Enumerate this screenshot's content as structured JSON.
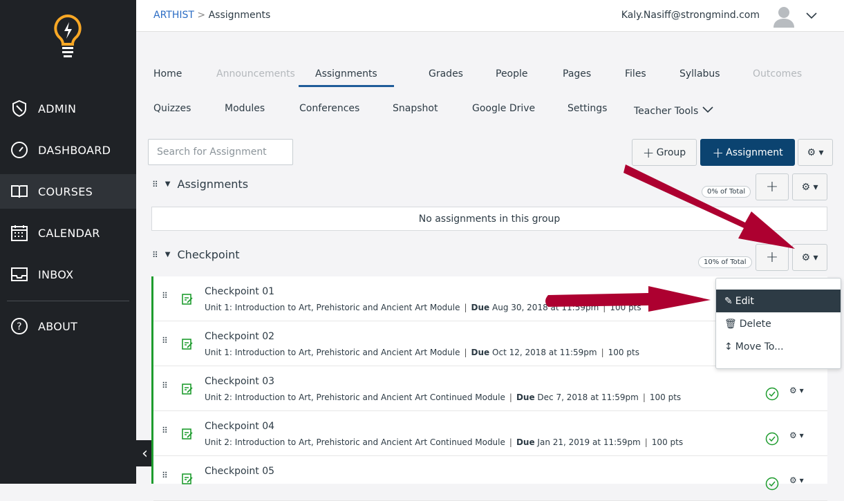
{
  "sidebar": {
    "items": [
      {
        "label": "ADMIN",
        "icon": "shield-icon"
      },
      {
        "label": "DASHBOARD",
        "icon": "dashboard-icon"
      },
      {
        "label": "COURSES",
        "icon": "book-icon",
        "active": true
      },
      {
        "label": "CALENDAR",
        "icon": "calendar-icon"
      },
      {
        "label": "INBOX",
        "icon": "inbox-icon"
      },
      {
        "label": "ABOUT",
        "icon": "help-icon"
      }
    ]
  },
  "header": {
    "breadcrumb_course": "ARTHIST",
    "breadcrumb_sep": ">",
    "breadcrumb_page": "Assignments",
    "user_email": "Kaly.Nasiff@strongmind.com"
  },
  "tabs": [
    "Home",
    "Announcements",
    "Assignments",
    "Grades",
    "People",
    "Pages",
    "Files",
    "Syllabus",
    "Outcomes",
    "Quizzes",
    "Modules",
    "Conferences",
    "Snapshot",
    "Google Drive",
    "Settings",
    "Teacher Tools"
  ],
  "toolbar": {
    "search_placeholder": "Search for Assignment",
    "group_button": "Group",
    "assignment_button": "Assignment"
  },
  "groups": [
    {
      "title": "Assignments",
      "weight": "0% of Total",
      "empty_text": "No assignments in this group"
    },
    {
      "title": "Checkpoint",
      "weight": "10% of Total"
    }
  ],
  "assignments": [
    {
      "title": "Checkpoint 01",
      "module": "Unit 1: Introduction to Art, Prehistoric and Ancient Art Module",
      "due_label": "Due",
      "due": "Aug 30, 2018 at 11:59pm",
      "points": "100 pts"
    },
    {
      "title": "Checkpoint 02",
      "module": "Unit 1: Introduction to Art, Prehistoric and Ancient Art Module",
      "due_label": "Due",
      "due": "Oct 12, 2018 at 11:59pm",
      "points": "100 pts"
    },
    {
      "title": "Checkpoint 03",
      "module": "Unit 2: Introduction to Art, Prehistoric and Ancient Art Continued Module",
      "due_label": "Due",
      "due": "Dec 7, 2018 at 11:59pm",
      "points": "100 pts",
      "published": true
    },
    {
      "title": "Checkpoint 04",
      "module": "Unit 2: Introduction to Art, Prehistoric and Ancient Art Continued Module",
      "due_label": "Due",
      "due": "Jan 21, 2019 at 11:59pm",
      "points": "100 pts",
      "published": true
    },
    {
      "title": "Checkpoint 05",
      "published": true
    }
  ],
  "menu": {
    "edit": "Edit",
    "delete": "Delete",
    "move": "Move To..."
  },
  "colors": {
    "sidebar": "#1f2226",
    "primary": "#0b4370",
    "published": "#1e9c2e",
    "annotation_arrow": "#ad0030"
  }
}
